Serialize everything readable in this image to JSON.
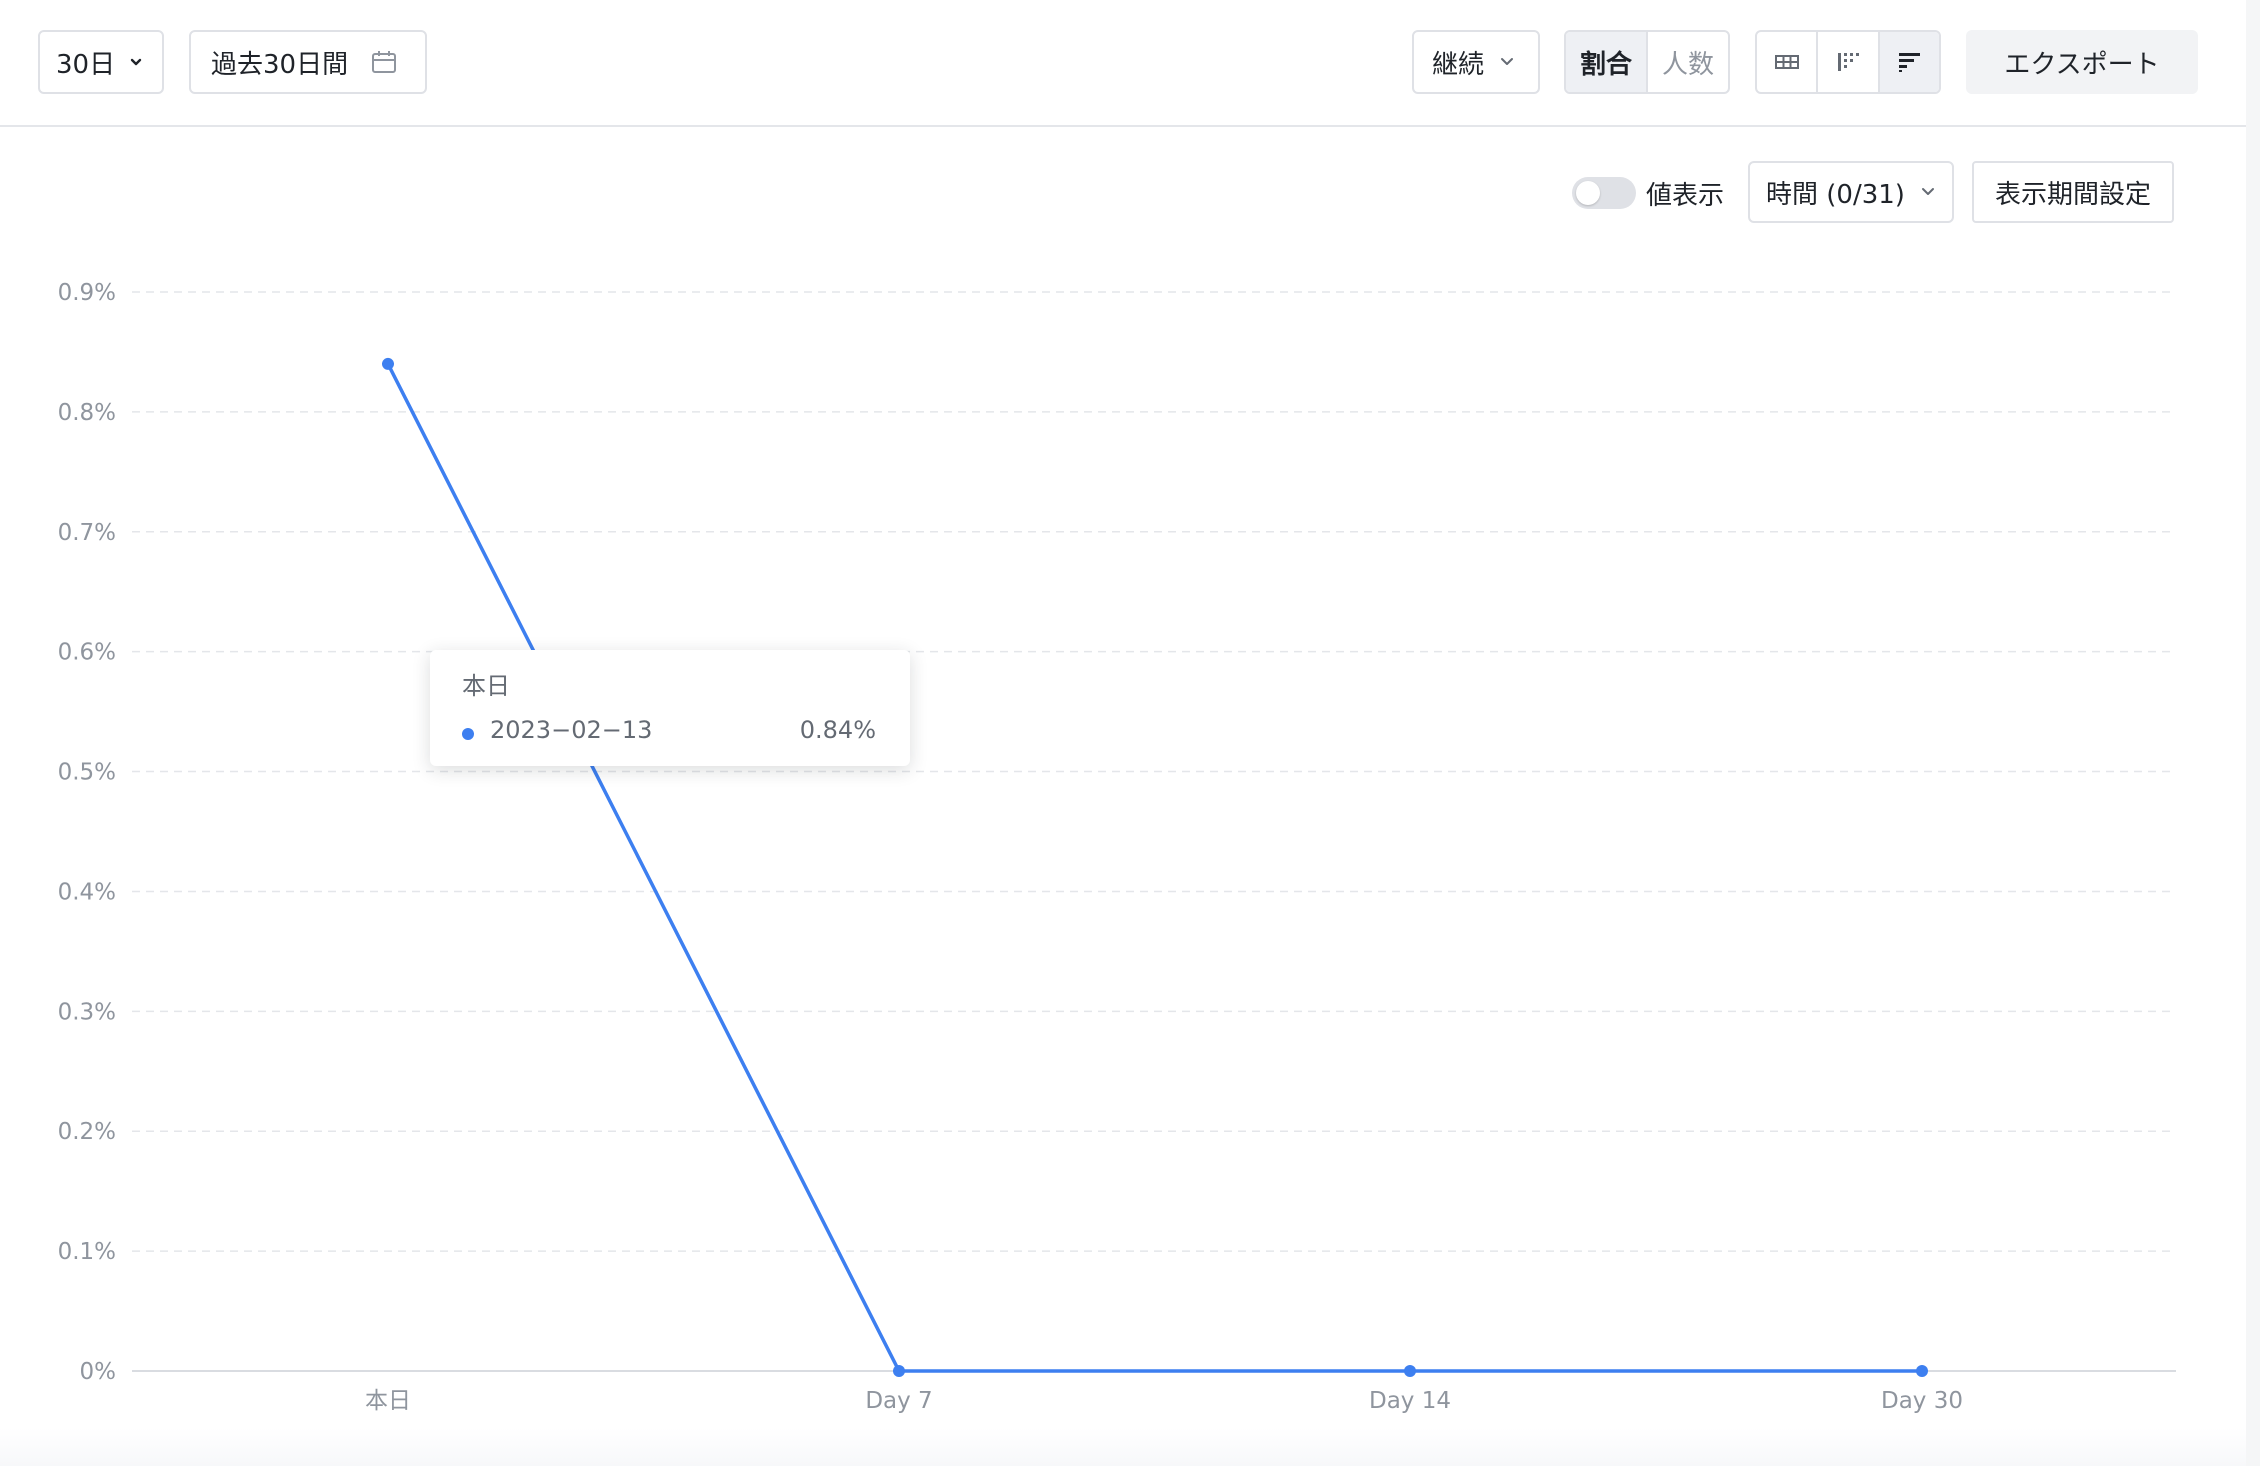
{
  "toolbar": {
    "days_select": "30日",
    "date_range": "過去30日間",
    "mode_select": "継続",
    "metric_toggle": [
      {
        "label": "割合",
        "active": true
      },
      {
        "label": "人数",
        "active": false
      }
    ],
    "view_modes": [
      {
        "icon": "table-icon",
        "active": false
      },
      {
        "icon": "cohort-triangle-icon",
        "active": false
      },
      {
        "icon": "cohort-bars-icon",
        "active": true
      }
    ],
    "export_label": "エクスポート"
  },
  "controls": {
    "value_toggle_label": "値表示",
    "value_toggle_on": false,
    "time_select": "時間 (0/31)",
    "period_button": "表示期間設定"
  },
  "colors": {
    "series": "#3d7ff0",
    "grid": "#e4e6ea",
    "axis_text": "#8f959e"
  },
  "tooltip": {
    "title": "本日",
    "items": [
      {
        "label": "2023−02−13",
        "value": "0.84%"
      }
    ]
  },
  "chart_data": {
    "type": "line",
    "categories": [
      "本日",
      "Day 7",
      "Day 14",
      "Day 30"
    ],
    "series": [
      {
        "values": [
          0.84,
          0,
          0,
          0
        ]
      }
    ],
    "y_ticks": [
      "0%",
      "0.1%",
      "0.2%",
      "0.3%",
      "0.4%",
      "0.5%",
      "0.6%",
      "0.7%",
      "0.8%",
      "0.9%"
    ],
    "ylim": [
      0,
      0.9
    ],
    "y_unit": "%",
    "grid": true
  }
}
